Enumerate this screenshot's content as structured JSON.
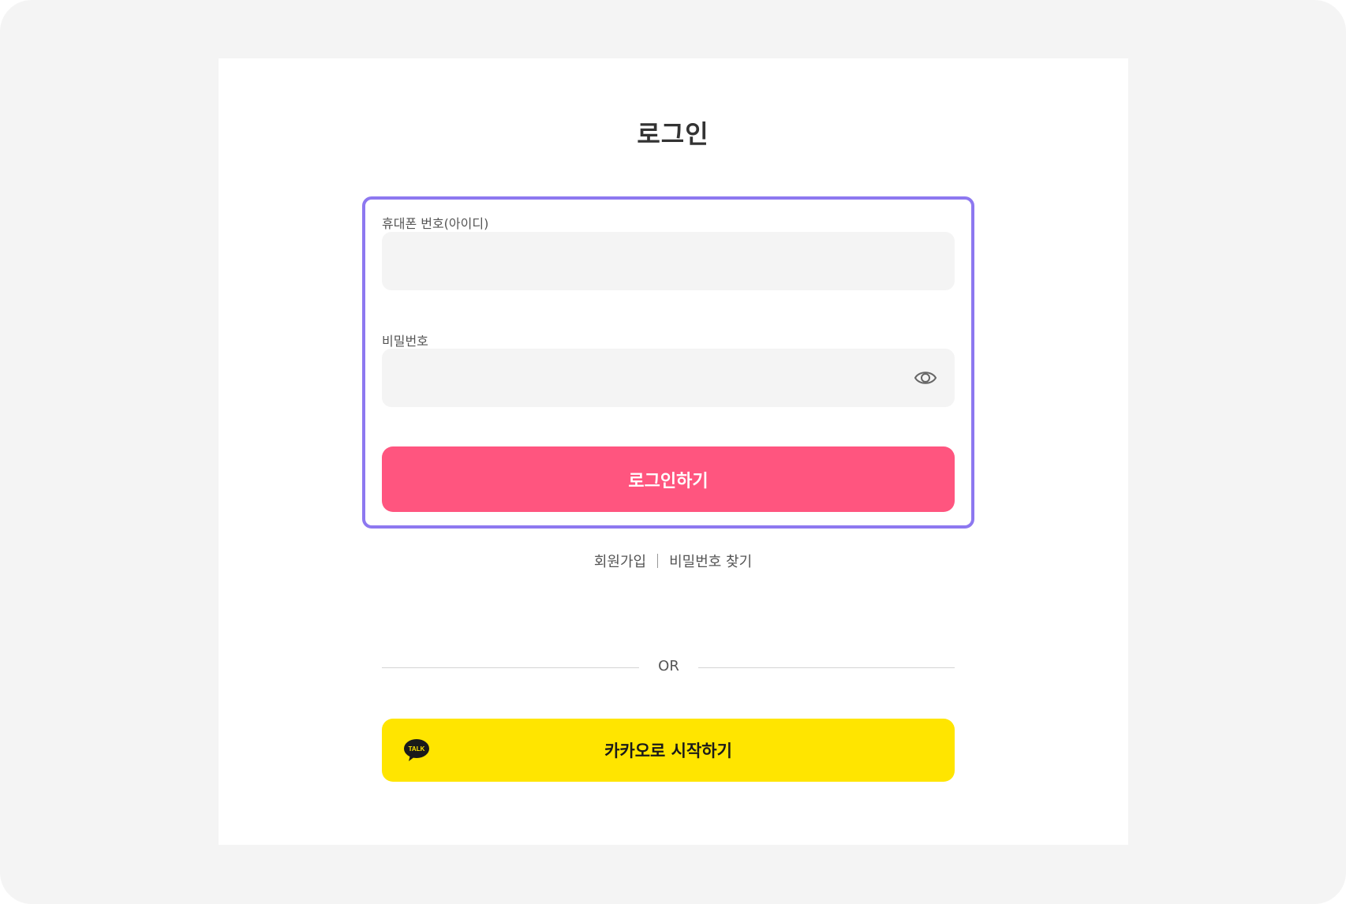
{
  "page": {
    "title": "로그인"
  },
  "form": {
    "phone_label": "휴대폰 번호(아이디)",
    "phone_value": "",
    "password_label": "비밀번호",
    "password_value": "",
    "submit_label": "로그인하기"
  },
  "links": {
    "signup": "회원가입",
    "find_password": "비밀번호 찾기"
  },
  "divider": {
    "text": "OR"
  },
  "kakao": {
    "label": "카카오로 시작하기",
    "icon_text": "TALK"
  },
  "colors": {
    "primary": "#ff557f",
    "kakao": "#ffe500",
    "highlight": "#8d78f0"
  }
}
